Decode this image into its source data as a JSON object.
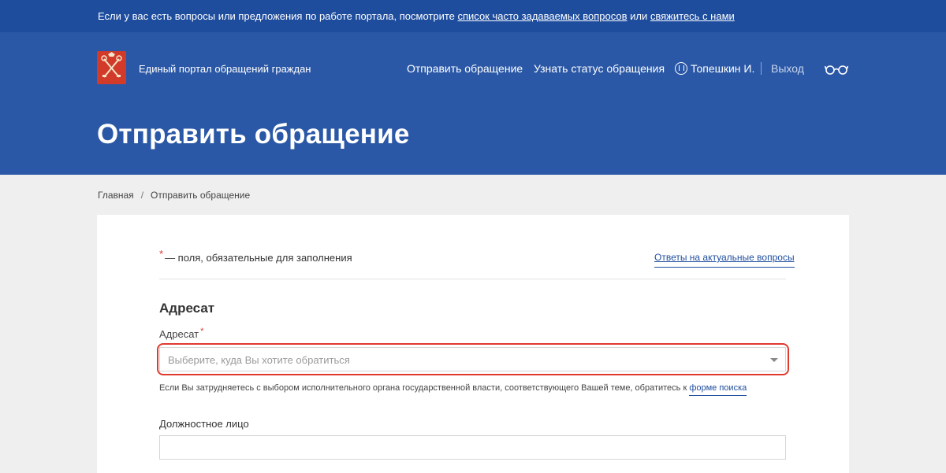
{
  "topbar": {
    "text": "Если у вас есть вопросы или предложения по работе портала, посмотрите ",
    "faq_link": "список часто задаваемых вопросов",
    "middle": " или ",
    "contact_link": "свяжитесь с нами"
  },
  "header": {
    "portal_name": "Единый портал обращений граждан",
    "nav": {
      "send": "Отправить обращение",
      "status": "Узнать статус обращения",
      "user": "Топешкин И.",
      "exit": "Выход"
    },
    "page_title": "Отправить обращение"
  },
  "breadcrumb": {
    "home": "Главная",
    "separator": "/",
    "current": "Отправить обращение"
  },
  "form": {
    "required_star": "*",
    "required_note": "— поля, обязательные для заполнения",
    "faq_link": "Ответы на актуальные вопросы",
    "section_title": "Адресат",
    "addressee_label": "Адресат",
    "addressee_placeholder": "Выберите, куда Вы хотите обратиться",
    "hint_text": "Если Вы затрудняетесь с выбором исполнительного органа государственной власти, соответствующего Вашей теме, обратитесь к ",
    "hint_link": "форме поиска",
    "official_label": "Должностное лицо",
    "official_value": ""
  },
  "colors": {
    "brand_blue": "#2b58a6",
    "topbar_blue": "#1e4d9e",
    "highlight_red": "#e03a2f",
    "required_red": "#e53935"
  }
}
